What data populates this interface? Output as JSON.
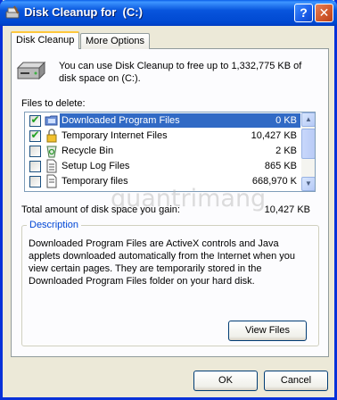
{
  "window": {
    "title": "Disk Cleanup for  (C:)",
    "help_glyph": "?",
    "close_glyph": "✕"
  },
  "tabs": [
    {
      "label": "Disk Cleanup"
    },
    {
      "label": "More Options"
    }
  ],
  "intro_text": "You can use Disk Cleanup to free up to 1,332,775 KB of disk space on  (C:).",
  "files_label": "Files to delete:",
  "files": [
    {
      "name": "Downloaded Program Files",
      "size": "0 KB",
      "checked": true,
      "selected": true,
      "icon": "folder-icon"
    },
    {
      "name": "Temporary Internet Files",
      "size": "10,427 KB",
      "checked": true,
      "selected": false,
      "icon": "lock-icon"
    },
    {
      "name": "Recycle Bin",
      "size": "2 KB",
      "checked": false,
      "selected": false,
      "icon": "recycle-bin-icon"
    },
    {
      "name": "Setup Log Files",
      "size": "865 KB",
      "checked": false,
      "selected": false,
      "icon": "document-icon"
    },
    {
      "name": "Temporary files",
      "size": "668,970 K",
      "checked": false,
      "selected": false,
      "icon": "document-icon"
    }
  ],
  "total": {
    "label": "Total amount of disk space you gain:",
    "value": "10,427 KB"
  },
  "description": {
    "title": "Description",
    "text": "Downloaded Program Files are ActiveX controls and Java applets downloaded automatically from the Internet when you view certain pages. They are temporarily stored in the Downloaded Program Files folder on your hard disk."
  },
  "buttons": {
    "view_files": "View Files",
    "ok": "OK",
    "cancel": "Cancel"
  },
  "watermark": "quantrimang"
}
